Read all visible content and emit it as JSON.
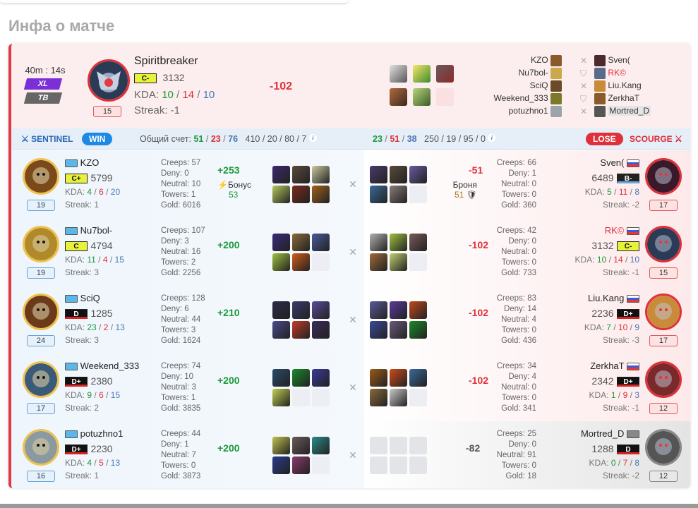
{
  "page_title": "Инфа о матче",
  "summary": {
    "duration": "40m : 14s",
    "mode1": "XL",
    "mode2": "TB",
    "hero_name": "Spiritbreaker",
    "rank": "C-",
    "mmr": "3132",
    "kda_label": "KDA:",
    "kda_k": "10",
    "kda_d": "14",
    "kda_a": "10",
    "sep": "/",
    "streak": "Streak: -1",
    "level": "15",
    "mmr_change": "-102",
    "left_players": [
      "KZO",
      "Nu7bol-",
      "SciQ",
      "Weekend_333",
      "potuzhno1"
    ],
    "right_players": [
      "Sven(",
      "RK©",
      "Liu.Kang",
      "ZerkhaT",
      "Mortred_D"
    ]
  },
  "bar": {
    "sentinel": "SENTINEL",
    "win": "WIN",
    "total_label": "Общий счет:",
    "s_k": "51",
    "s_d": "23",
    "s_a": "76",
    "s_extra": "410 / 20 / 80 / 7",
    "r_k": "23",
    "r_d": "51",
    "r_a": "38",
    "r_extra": "250 / 19 / 95 / 0",
    "lose": "LOSE",
    "scourge": "SCOURGE"
  },
  "labels": {
    "kda": "KDA:",
    "creeps": "Creeps:",
    "deny": "Deny:",
    "neutral": "Neutral:",
    "towers": "Towers:",
    "gold": "Gold:",
    "bonus": "Бонус",
    "armor": "Броня"
  },
  "sentinel_players": [
    {
      "name": "KZO",
      "rank": "C+",
      "mmr": "5799",
      "k": "4",
      "d": "6",
      "a": "20",
      "streak": "Streak: 1",
      "level": "19",
      "creeps": "57",
      "deny": "0",
      "neutral": "10",
      "towers": "1",
      "gold": "6016",
      "change": "+253",
      "bonus": "53"
    },
    {
      "name": "Nu7bol-",
      "rank": "C",
      "mmr": "4794",
      "k": "11",
      "d": "4",
      "a": "15",
      "streak": "Streak: 3",
      "level": "19",
      "creeps": "107",
      "deny": "3",
      "neutral": "16",
      "towers": "2",
      "gold": "2256",
      "change": "+200"
    },
    {
      "name": "SciQ",
      "rank": "D",
      "mmr": "1285",
      "k": "23",
      "d": "2",
      "a": "13",
      "streak": "Streak: 3",
      "level": "24",
      "creeps": "128",
      "deny": "6",
      "neutral": "44",
      "towers": "3",
      "gold": "1624",
      "change": "+210"
    },
    {
      "name": "Weekend_333",
      "rank": "D+",
      "mmr": "2380",
      "k": "9",
      "d": "6",
      "a": "15",
      "streak": "Streak: 2",
      "level": "17",
      "creeps": "74",
      "deny": "10",
      "neutral": "3",
      "towers": "1",
      "gold": "3835",
      "change": "+200"
    },
    {
      "name": "potuzhno1",
      "rank": "D+",
      "mmr": "2230",
      "k": "4",
      "d": "5",
      "a": "13",
      "streak": "Streak: 1",
      "level": "16",
      "creeps": "44",
      "deny": "1",
      "neutral": "7",
      "towers": "0",
      "gold": "3873",
      "change": "+200"
    }
  ],
  "scourge_players": [
    {
      "name": "Sven(",
      "rank": "B-",
      "mmr": "6489",
      "k": "5",
      "d": "11",
      "a": "8",
      "streak": "Streak: -2",
      "level": "17",
      "creeps": "66",
      "deny": "1",
      "neutral": "0",
      "towers": "0",
      "gold": "360",
      "change": "-51",
      "armor": "51"
    },
    {
      "name": "RK©",
      "rank": "C-",
      "mmr": "3132",
      "k": "10",
      "d": "14",
      "a": "10",
      "streak": "Streak: -1",
      "level": "15",
      "creeps": "42",
      "deny": "0",
      "neutral": "0",
      "towers": "0",
      "gold": "733",
      "change": "-102"
    },
    {
      "name": "Liu.Kang",
      "rank": "D+",
      "mmr": "2236",
      "k": "7",
      "d": "10",
      "a": "9",
      "streak": "Streak: -3",
      "level": "17",
      "creeps": "83",
      "deny": "14",
      "neutral": "4",
      "towers": "0",
      "gold": "436",
      "change": "-102"
    },
    {
      "name": "ZerkhaT",
      "rank": "D+",
      "mmr": "2342",
      "k": "1",
      "d": "9",
      "a": "3",
      "streak": "Streak: -1",
      "level": "12",
      "creeps": "34",
      "deny": "4",
      "neutral": "0",
      "towers": "0",
      "gold": "341",
      "change": "-102"
    },
    {
      "name": "Mortred_D",
      "rank": "D",
      "mmr": "1288",
      "k": "0",
      "d": "7",
      "a": "8",
      "streak": "Streak: -2",
      "level": "12",
      "creeps": "25",
      "deny": "0",
      "neutral": "91",
      "towers": "0",
      "gold": "18",
      "change": "-82"
    }
  ],
  "colors": {
    "win": "#1e88e5",
    "lose": "#e0303a",
    "kills": "#1b9a3a",
    "deaths": "#e0303a",
    "assists": "#4a78b5"
  }
}
